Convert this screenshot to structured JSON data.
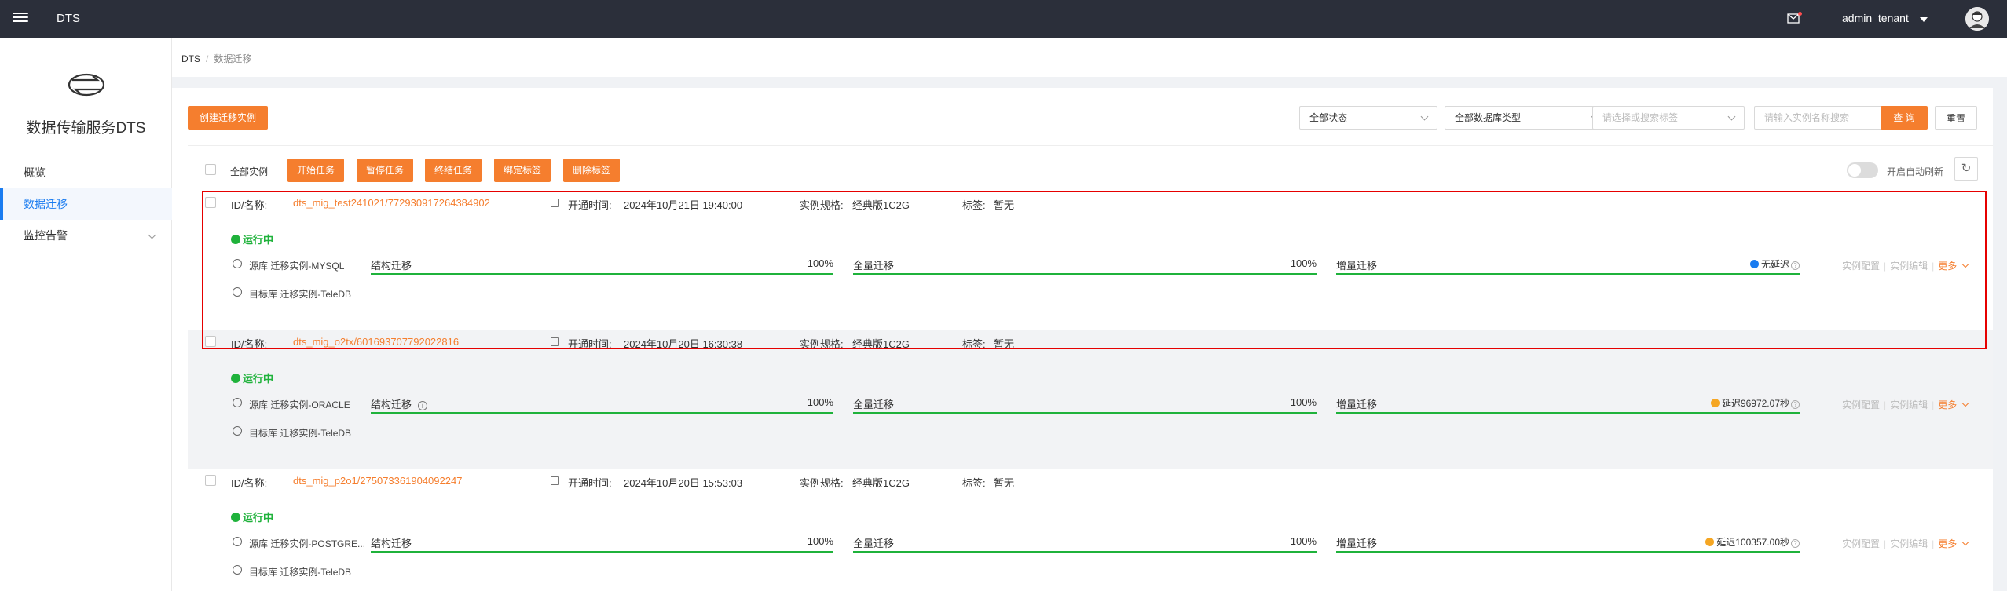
{
  "topbar": {
    "title": "DTS",
    "user": "admin_tenant"
  },
  "sidebar": {
    "brand": "数据传输服务DTS",
    "items": [
      {
        "label": "概览"
      },
      {
        "label": "数据迁移"
      },
      {
        "label": "监控告警"
      }
    ]
  },
  "breadcrumb": {
    "root": "DTS",
    "current": "数据迁移"
  },
  "toolbar": {
    "create": "创建迁移实例",
    "status_select": "全部状态",
    "dbtype_select": "全部数据库类型",
    "tag_placeholder": "请选择或搜索标签",
    "search_placeholder": "请输入实例名称搜索",
    "query": "查 询",
    "reset": "重置"
  },
  "bulk": {
    "select_all": "全部实例",
    "start": "开始任务",
    "pause": "暂停任务",
    "stop": "终结任务",
    "bind_tag": "绑定标签",
    "delete_tag": "删除标签",
    "auto_refresh": "开启自动刷新"
  },
  "labels": {
    "id_name": "ID/名称:",
    "open_time": "开通时间:",
    "spec": "实例规格:",
    "tag": "标签:",
    "source": "源库",
    "target": "目标库",
    "struct": "结构迁移",
    "full": "全量迁移",
    "incr": "增量迁移",
    "cfg": "实例配置",
    "edit": "实例编辑",
    "more": "更多"
  },
  "tasks": [
    {
      "id": "dts_mig_test241021/772930917264384902",
      "open_time": "2024年10月21日 19:40:00",
      "spec": "经典版1C2G",
      "tag": "暂无",
      "status": "运行中",
      "source": "迁移实例-MYSQL",
      "target": "迁移实例-TeleDB",
      "struct_pct": "100%",
      "full_pct": "100%",
      "struct_progress": 1.0,
      "full_progress": 1.0,
      "incr_progress": 1.0,
      "delay": "无延迟",
      "delay_color": "#1a7cf0"
    },
    {
      "id": "dts_mig_o2tx/601693707792022816",
      "open_time": "2024年10月20日 16:30:38",
      "spec": "经典版1C2G",
      "tag": "暂无",
      "status": "运行中",
      "source": "迁移实例-ORACLE",
      "target": "迁移实例-TeleDB",
      "struct_pct": "100%",
      "full_pct": "100%",
      "struct_progress": 1.0,
      "full_progress": 1.0,
      "incr_progress": 1.0,
      "delay": "延迟96972.07秒",
      "delay_color": "#f5a623"
    },
    {
      "id": "dts_mig_p2o1/275073361904092247",
      "open_time": "2024年10月20日 15:53:03",
      "spec": "经典版1C2G",
      "tag": "暂无",
      "status": "运行中",
      "source": "迁移实例-POSTGRE...",
      "target": "迁移实例-TeleDB",
      "struct_pct": "100%",
      "full_pct": "100%",
      "struct_progress": 1.0,
      "full_progress": 1.0,
      "incr_progress": 1.0,
      "delay": "延迟100357.00秒",
      "delay_color": "#f5a623"
    }
  ],
  "colors": {
    "accent": "#f57e2e",
    "topbar": "#2b2f3a",
    "running": "#1fb23b",
    "nav_active": "#1a7cf0"
  }
}
